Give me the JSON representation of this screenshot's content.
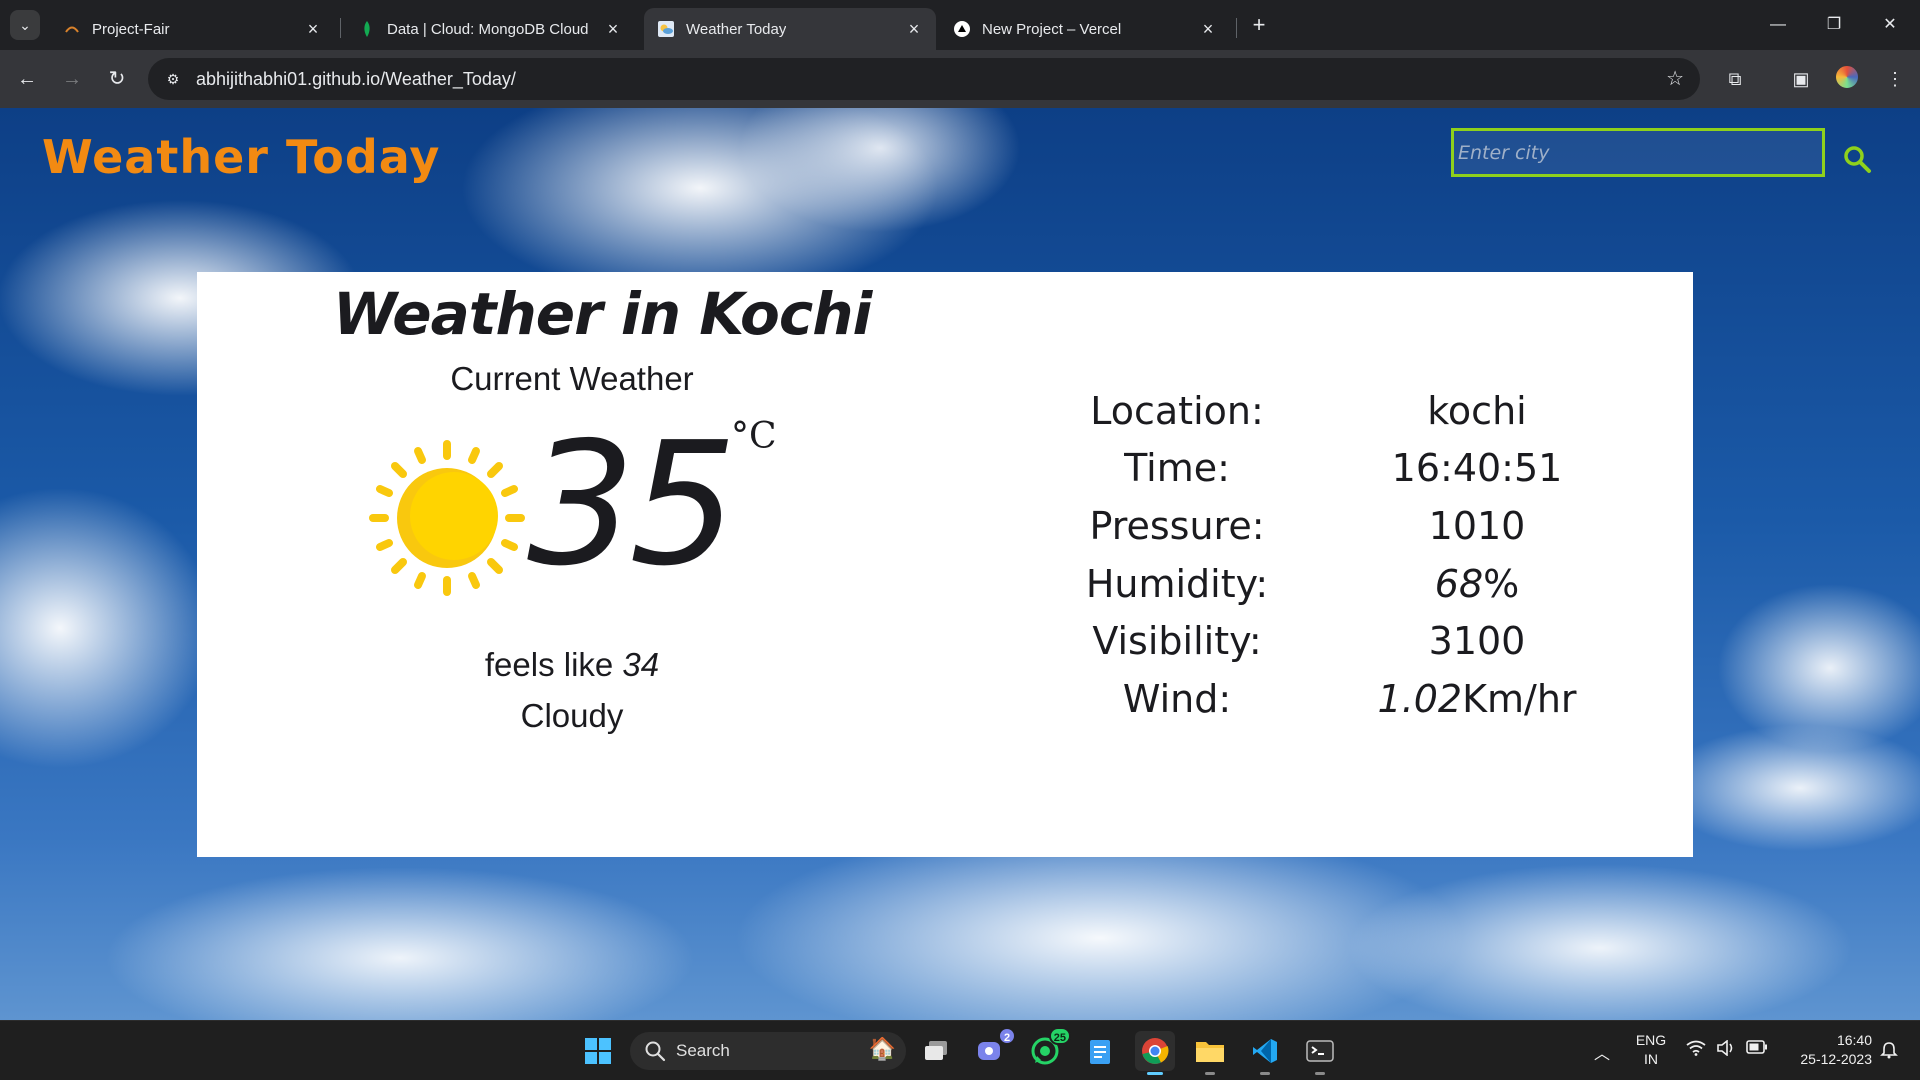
{
  "browser": {
    "tabs": [
      {
        "title": "Project-Fair",
        "favicon": "project-fair-favicon",
        "active": false
      },
      {
        "title": "Data | Cloud: MongoDB Cloud",
        "favicon": "mongodb-leaf-icon",
        "active": false
      },
      {
        "title": "Weather Today",
        "favicon": "weather-favicon",
        "active": true
      },
      {
        "title": "New Project – Vercel",
        "favicon": "vercel-triangle-icon",
        "active": false
      }
    ],
    "url": "abhijithabhi01.github.io/Weather_Today/"
  },
  "page": {
    "brand": "Weather Today",
    "brand_color": "#f28a12",
    "search_placeholder": "Enter city",
    "search_accent": "#8fd11c",
    "card": {
      "title": "Weather in Kochi",
      "subtitle": "Current Weather",
      "temperature": "35",
      "unit": "°C",
      "feels_like_label": "feels like",
      "feels_like_value": "34",
      "condition": "Cloudy",
      "weather_icon": "sun-icon",
      "details": [
        {
          "label": "Location:",
          "value": "kochi"
        },
        {
          "label": "Time:",
          "value": "16:40:51"
        },
        {
          "label": "Pressure:",
          "value": "1010"
        },
        {
          "label": "Humidity:",
          "value": "68",
          "suffix": "%"
        },
        {
          "label": "Visibility:",
          "value": "3100"
        },
        {
          "label": "Wind:",
          "value": "1.02",
          "suffix": "Km/hr"
        }
      ]
    }
  },
  "taskbar": {
    "search_label": "Search",
    "badges": {
      "teams": "2",
      "whatsapp": "25"
    },
    "language": "ENG",
    "region": "IN",
    "time": "16:40",
    "date": "25-12-2023"
  }
}
